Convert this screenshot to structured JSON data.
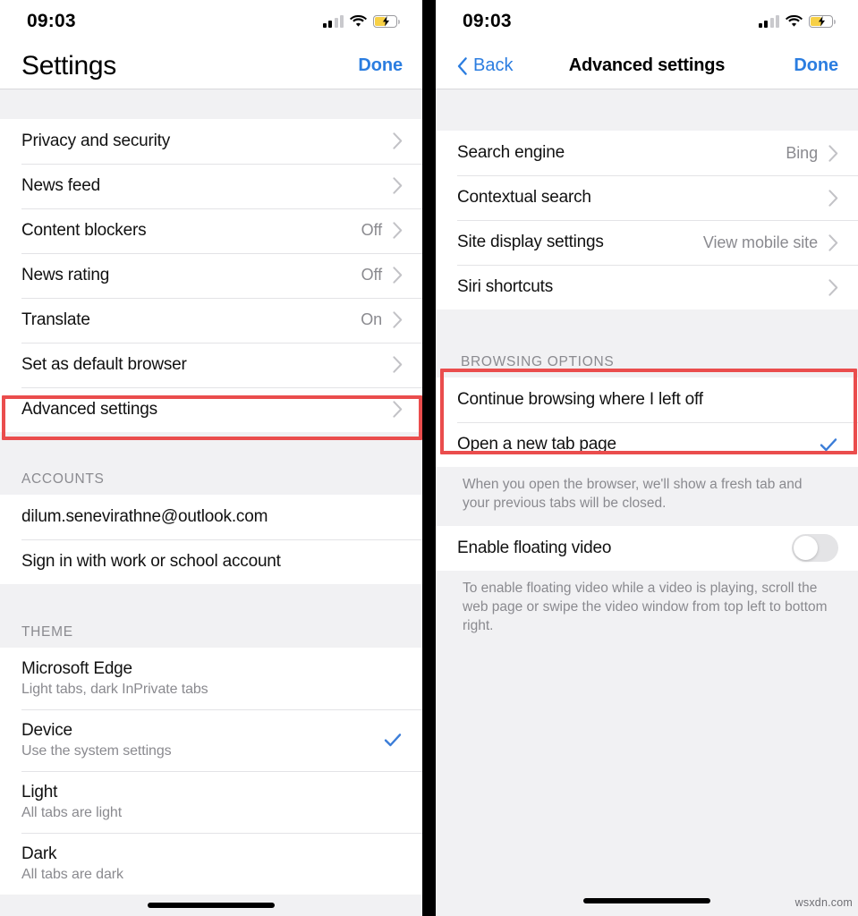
{
  "status_bar": {
    "time": "09:03",
    "cell_icon": "cellular-signal-icon",
    "cell_bars_filled": 2,
    "cell_bars_total": 4,
    "wifi_icon": "wifi-icon",
    "battery_icon": "battery-charging-icon",
    "battery_color": "#f7d046"
  },
  "colors": {
    "accent_blue": "#2b7de0",
    "check_blue": "#3b7dd8",
    "highlight_red": "#ea4d4d",
    "group_bg": "#f1f1f3",
    "secondary_text": "#8a8a8f"
  },
  "left_screen": {
    "nav": {
      "title": "Settings",
      "done_label": "Done"
    },
    "settings_rows": [
      {
        "title": "Privacy and security",
        "value": "",
        "accessory": "chevron-right-icon"
      },
      {
        "title": "News feed",
        "value": "",
        "accessory": "chevron-right-icon"
      },
      {
        "title": "Content blockers",
        "value": "Off",
        "accessory": "chevron-right-icon"
      },
      {
        "title": "News rating",
        "value": "Off",
        "accessory": "chevron-right-icon"
      },
      {
        "title": "Translate",
        "value": "On",
        "accessory": "chevron-right-icon"
      },
      {
        "title": "Set as default browser",
        "value": "",
        "accessory": "chevron-right-icon"
      },
      {
        "title": "Advanced settings",
        "value": "",
        "accessory": "chevron-right-icon",
        "highlighted": true
      }
    ],
    "accounts_section": {
      "header": "ACCOUNTS",
      "rows": [
        {
          "title": "dilum.senevirathne@outlook.com"
        },
        {
          "title": "Sign in with work or school account"
        }
      ]
    },
    "theme_section": {
      "header": "THEME",
      "rows": [
        {
          "title": "Microsoft Edge",
          "subtitle": "Light tabs, dark InPrivate tabs",
          "selected": false
        },
        {
          "title": "Device",
          "subtitle": "Use the system settings",
          "selected": true
        },
        {
          "title": "Light",
          "subtitle": "All tabs are light",
          "selected": false
        },
        {
          "title": "Dark",
          "subtitle": "All tabs are dark",
          "selected": false
        }
      ]
    }
  },
  "right_screen": {
    "nav": {
      "back_label": "Back",
      "back_icon": "chevron-left-icon",
      "title": "Advanced settings",
      "done_label": "Done"
    },
    "top_rows": [
      {
        "title": "Search engine",
        "value": "Bing",
        "accessory": "chevron-right-icon"
      },
      {
        "title": "Contextual search",
        "value": "",
        "accessory": "chevron-right-icon"
      },
      {
        "title": "Site display settings",
        "value": "View mobile site",
        "accessory": "chevron-right-icon"
      },
      {
        "title": "Siri shortcuts",
        "value": "",
        "accessory": "chevron-right-icon"
      }
    ],
    "browsing_section": {
      "header": "BROWSING OPTIONS",
      "highlighted": true,
      "rows": [
        {
          "title": "Continue browsing where I left off",
          "selected": false
        },
        {
          "title": "Open a new tab page",
          "selected": true
        }
      ],
      "footnote": "When you open the browser, we'll show a fresh tab and your previous tabs will be closed."
    },
    "floating_video_section": {
      "row": {
        "title": "Enable floating video",
        "toggle_on": false
      },
      "footnote": "To enable floating video while a video is playing, scroll the web page or swipe the video window from top left to bottom right."
    }
  },
  "watermark": "wsxdn.com"
}
